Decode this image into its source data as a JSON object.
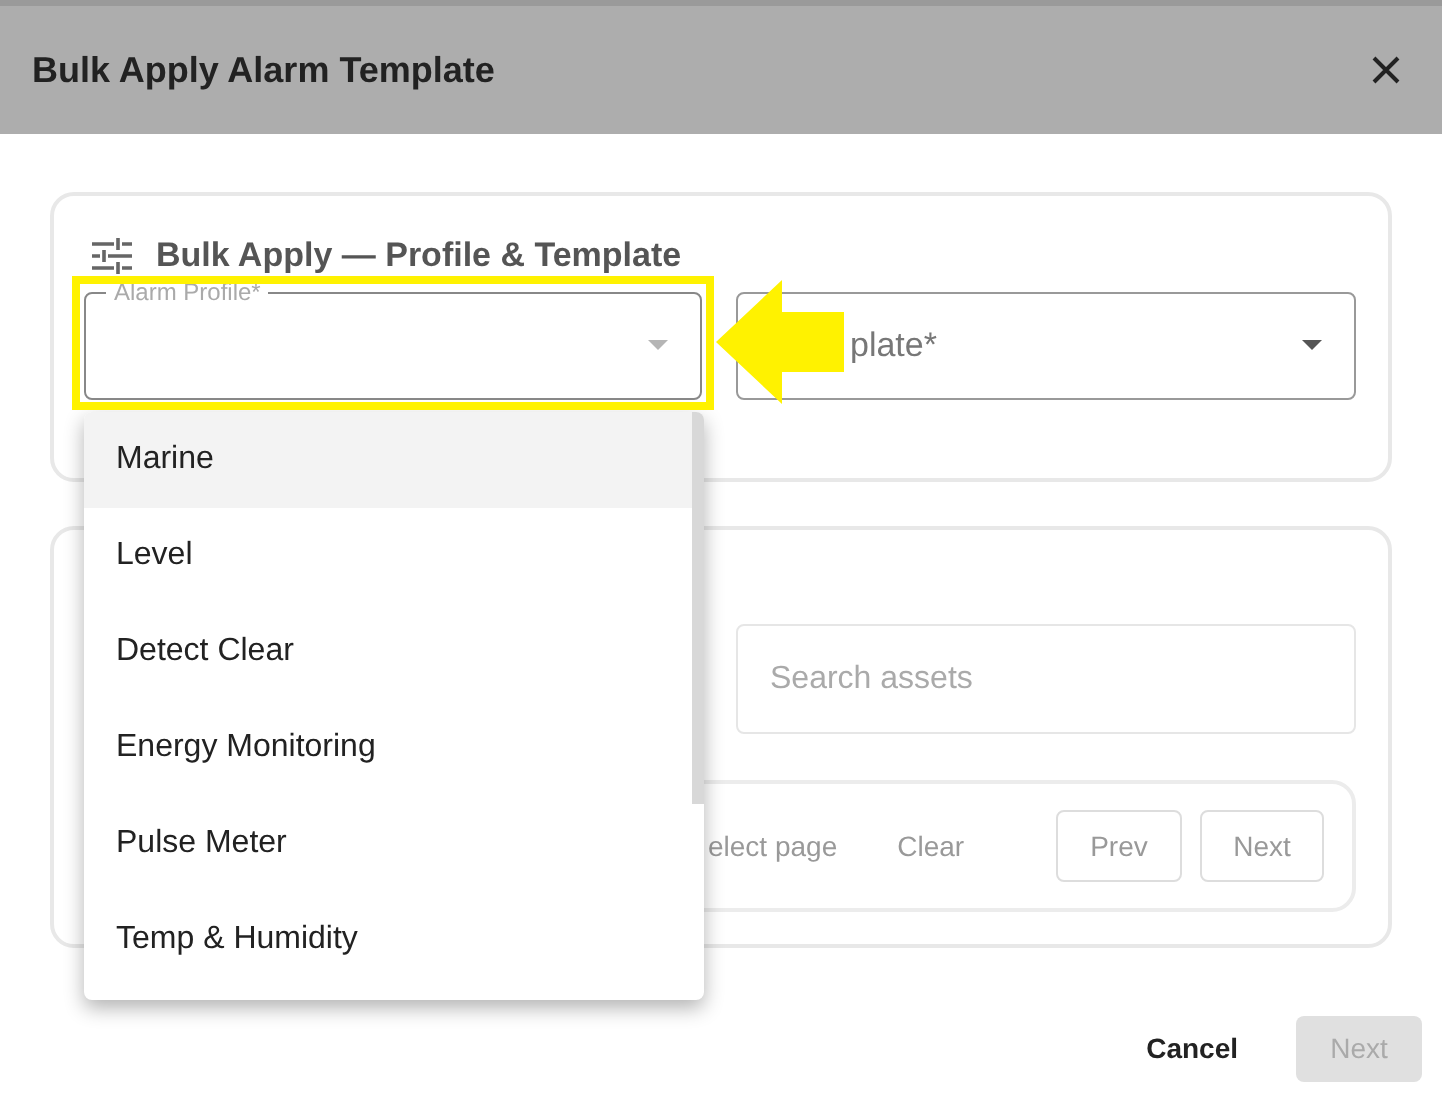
{
  "dialog": {
    "title": "Bulk Apply Alarm Template"
  },
  "profile_card": {
    "title": "Bulk Apply — Profile & Template",
    "alarm_profile": {
      "label": "Alarm Profile*",
      "expanded": true
    },
    "template": {
      "label": "plate*"
    }
  },
  "assets_card": {
    "search": {
      "placeholder": "Search assets"
    },
    "toolbar": {
      "select_page": "elect page",
      "clear": "Clear",
      "prev": "Prev",
      "next": "Next"
    }
  },
  "menu": {
    "items": [
      {
        "label": "Marine",
        "selected": true
      },
      {
        "label": "Level",
        "selected": false
      },
      {
        "label": "Detect Clear",
        "selected": false
      },
      {
        "label": "Energy Monitoring",
        "selected": false
      },
      {
        "label": "Pulse Meter",
        "selected": false
      },
      {
        "label": "Temp & Humidity",
        "selected": false
      }
    ]
  },
  "footer": {
    "cancel": "Cancel",
    "next": {
      "label": "Next",
      "disabled": true
    }
  }
}
